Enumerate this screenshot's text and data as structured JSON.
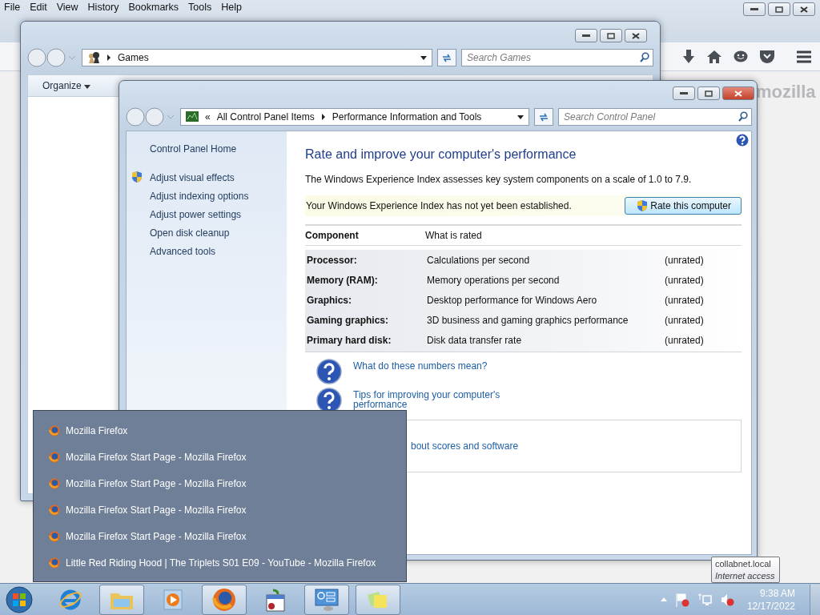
{
  "firefox": {
    "menu": [
      "File",
      "Edit",
      "View",
      "History",
      "Bookmarks",
      "Tools",
      "Help"
    ],
    "brand": "mozilla"
  },
  "games_window": {
    "address": "Games",
    "search": {
      "placeholder": "Search Games"
    },
    "toolbar": [
      "Organize"
    ]
  },
  "control_panel": {
    "breadcrumb_overflow": "«",
    "breadcrumb": [
      "All Control Panel Items",
      "Performance Information and Tools"
    ],
    "search": {
      "placeholder": "Search Control Panel"
    },
    "sidebar": {
      "home": "Control Panel Home",
      "items": [
        {
          "label": "Adjust visual effects",
          "shield": true
        },
        {
          "label": "Adjust indexing options",
          "shield": false
        },
        {
          "label": "Adjust power settings",
          "shield": false
        },
        {
          "label": "Open disk cleanup",
          "shield": false
        },
        {
          "label": "Advanced tools",
          "shield": false
        }
      ]
    },
    "heading": "Rate and improve your computer's performance",
    "description": "The Windows Experience Index assesses key system components on a scale of 1.0 to 7.9.",
    "notice": "Your Windows Experience Index has not yet been established.",
    "rate_button": "Rate this computer",
    "table": {
      "columns": [
        "Component",
        "What is rated"
      ],
      "rows": [
        {
          "component": "Processor:",
          "rated": "Calculations per second",
          "score": "(unrated)"
        },
        {
          "component": "Memory (RAM):",
          "rated": "Memory operations per second",
          "score": "(unrated)"
        },
        {
          "component": "Graphics:",
          "rated": "Desktop performance for Windows Aero",
          "score": "(unrated)"
        },
        {
          "component": "Gaming graphics:",
          "rated": "3D business and gaming graphics performance",
          "score": "(unrated)"
        },
        {
          "component": "Primary hard disk:",
          "rated": "Disk data transfer rate",
          "score": "(unrated)"
        }
      ]
    },
    "help_links": [
      "What do these numbers mean?",
      "Tips for improving your computer's performance"
    ],
    "box_link": "bout scores and software"
  },
  "jump_list": {
    "items": [
      "Mozilla Firefox",
      "Mozilla Firefox Start Page - Mozilla Firefox",
      "Mozilla Firefox Start Page - Mozilla Firefox",
      "Mozilla Firefox Start Page - Mozilla Firefox",
      "Mozilla Firefox Start Page - Mozilla Firefox",
      "Little Red Riding Hood | The Triplets S01 E09 - YouTube - Mozilla Firefox"
    ]
  },
  "tooltip": {
    "title": "collabnet.local",
    "subtitle": "Internet access"
  },
  "taskbar": {
    "apps": [
      {
        "kind": "ie",
        "running": false
      },
      {
        "kind": "explorer",
        "running": true
      },
      {
        "kind": "media",
        "running": false
      },
      {
        "kind": "firefox",
        "running": true
      },
      {
        "kind": "calendar",
        "running": false
      },
      {
        "kind": "controlpanel",
        "running": true
      },
      {
        "kind": "notes",
        "running": true
      }
    ],
    "time": "9:38 AM",
    "date": "12/17/2022"
  }
}
